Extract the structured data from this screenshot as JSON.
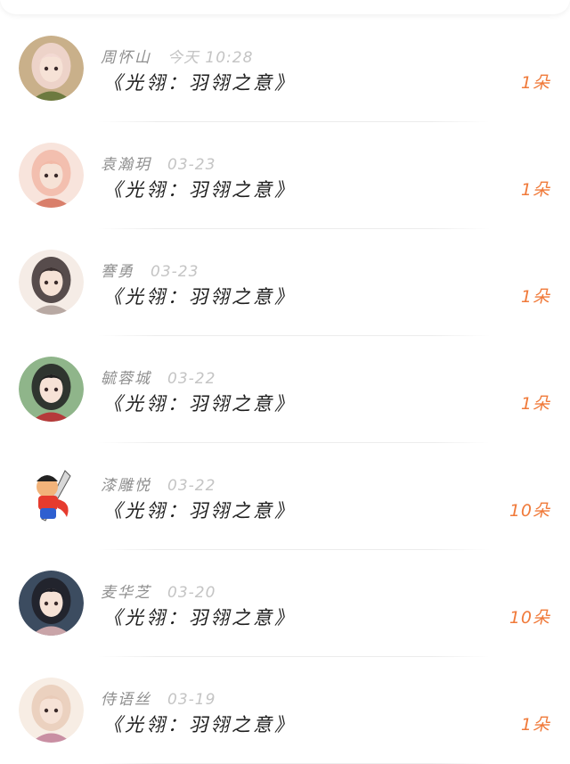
{
  "records": [
    {
      "name": "周怀山",
      "time": "今天 10:28",
      "title": "《光翎：羽翎之意》",
      "amount": "1朵",
      "avatar": "avatar-photo-girl-icon",
      "colors": [
        "#c9b08a",
        "#f3d9d3",
        "#6d7a3f"
      ]
    },
    {
      "name": "袁瀚玥",
      "time": "03-23",
      "title": "《光翎：羽翎之意》",
      "amount": "1朵",
      "avatar": "avatar-anime-girl-icon",
      "colors": [
        "#f8e4dc",
        "#f2b9a7",
        "#d97f6b"
      ]
    },
    {
      "name": "謇勇",
      "time": "03-23",
      "title": "《光翎：羽翎之意》",
      "amount": "1朵",
      "avatar": "avatar-chibi-girl-icon",
      "colors": [
        "#f5ece6",
        "#3b3030",
        "#b8a9a3"
      ]
    },
    {
      "name": "毓蓉城",
      "time": "03-22",
      "title": "《光翎：羽翎之意》",
      "amount": "1朵",
      "avatar": "avatar-girl-outdoor-icon",
      "colors": [
        "#8fb58a",
        "#1f1f1f",
        "#b53a3a"
      ]
    },
    {
      "name": "漆雕悦",
      "time": "03-22",
      "title": "《光翎：羽翎之意》",
      "amount": "10朵",
      "avatar": "avatar-cartoon-warrior-icon",
      "colors": [
        "#ffffff",
        "#e63b2e",
        "#2e5fd0"
      ]
    },
    {
      "name": "麦华芝",
      "time": "03-20",
      "title": "《光翎：羽翎之意》",
      "amount": "10朵",
      "avatar": "avatar-anime-couple-icon",
      "colors": [
        "#3c4c60",
        "#1d1d25",
        "#c9a4a8"
      ]
    },
    {
      "name": "侍语丝",
      "time": "03-19",
      "title": "《光翎：羽翎之意》",
      "amount": "1朵",
      "avatar": "avatar-anime-princess-icon",
      "colors": [
        "#f7ede4",
        "#e9cbb8",
        "#c98fa3"
      ]
    }
  ]
}
